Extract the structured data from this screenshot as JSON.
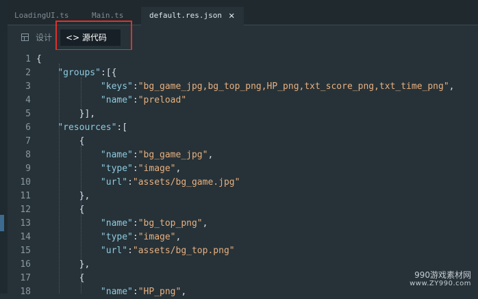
{
  "tabs": [
    {
      "label": "LoadingUI.ts"
    },
    {
      "label": "Main.ts"
    },
    {
      "label": "default.res.json"
    }
  ],
  "tab_close_glyph": "✕",
  "view_switch": {
    "design_label": "设计",
    "source_label": "<> 源代码"
  },
  "editor": {
    "line_numbers": [
      "1",
      "2",
      "3",
      "4",
      "5",
      "6",
      "7",
      "8",
      "9",
      "10",
      "11",
      "12",
      "13",
      "14",
      "15",
      "16",
      "17",
      "18"
    ],
    "lines": [
      "{",
      "    \"groups\":[{",
      "            \"keys\":\"bg_game_jpg,bg_top_png,HP_png,txt_score_png,txt_time_png\",",
      "            \"name\":\"preload\"",
      "        }],",
      "    \"resources\":[",
      "        {",
      "            \"name\":\"bg_game_jpg\",",
      "            \"type\":\"image\",",
      "            \"url\":\"assets/bg_game.jpg\"",
      "        },",
      "        {",
      "            \"name\":\"bg_top_png\",",
      "            \"type\":\"image\",",
      "            \"url\":\"assets/bg_top.png\"",
      "        },",
      "        {",
      "            \"name\":\"HP_png\","
    ]
  },
  "watermark": {
    "line1": "990游戏素材网",
    "line2": "www.ZY990.com"
  }
}
